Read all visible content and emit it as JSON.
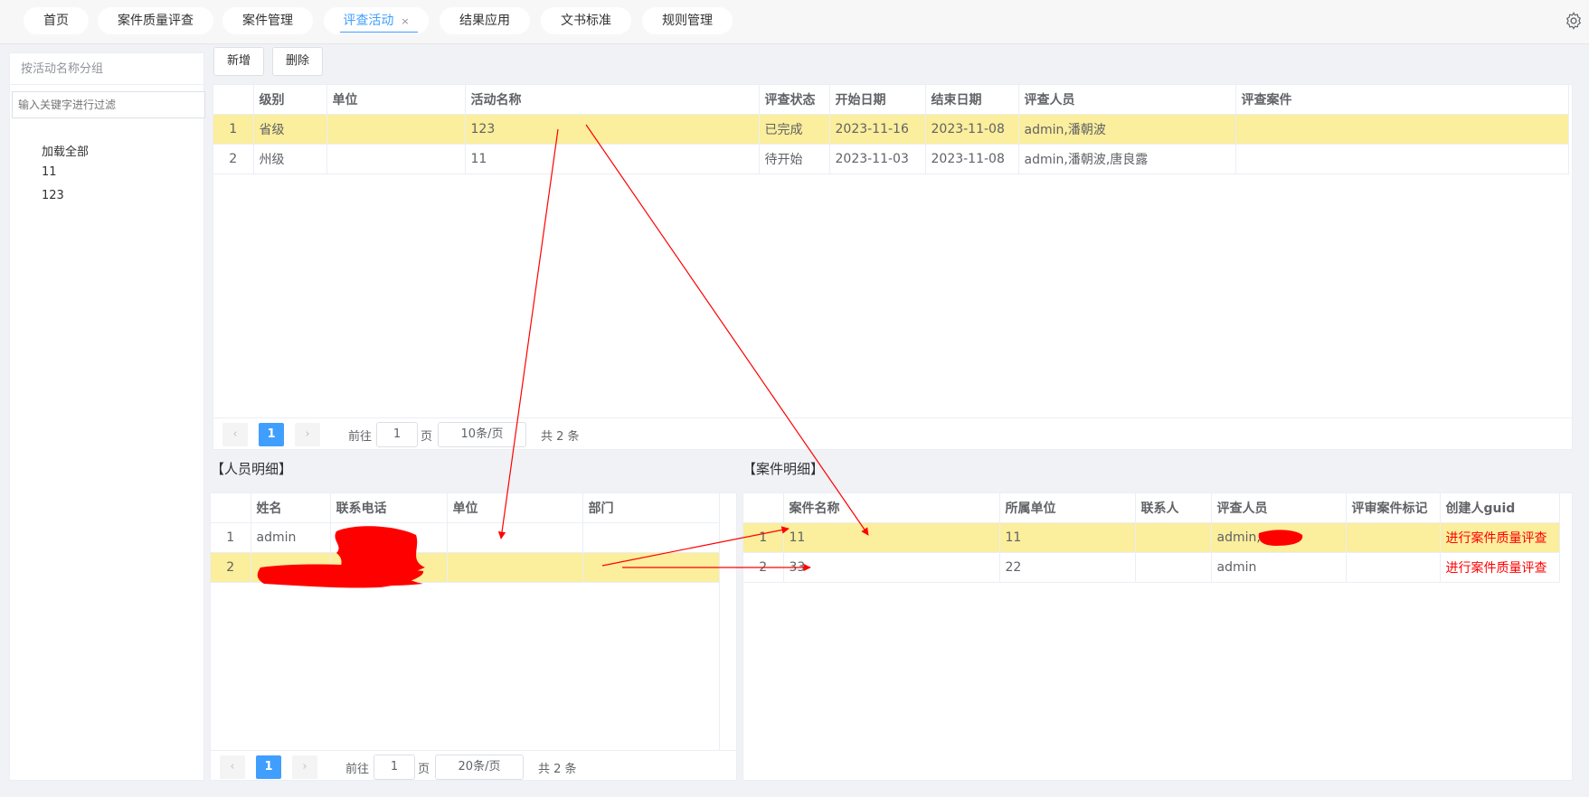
{
  "tabs": [
    {
      "label": "首页"
    },
    {
      "label": "案件质量评查"
    },
    {
      "label": "案件管理"
    },
    {
      "label": "评查活动",
      "close": "×"
    },
    {
      "label": "结果应用"
    },
    {
      "label": "文书标准"
    },
    {
      "label": "规则管理"
    }
  ],
  "sidebar": {
    "group_title": "按活动名称分组",
    "filter_placeholder": "输入关键字进行过滤",
    "items": [
      {
        "label": "加载全部"
      },
      {
        "label": "11"
      },
      {
        "label": "123"
      }
    ]
  },
  "toolbar": {
    "add_label": "新增",
    "delete_label": "删除"
  },
  "activity_table": {
    "columns": [
      "",
      "级别",
      "单位",
      "活动名称",
      "评查状态",
      "开始日期",
      "结束日期",
      "评查人员",
      "评查案件"
    ],
    "rows": [
      {
        "idx": "1",
        "level": "省级",
        "unit": "",
        "name": "123",
        "status": "已完成",
        "start": "2023-11-16",
        "end": "2023-11-08",
        "reviewers": "admin,潘朝波",
        "cases": ""
      },
      {
        "idx": "2",
        "level": "州级",
        "unit": "",
        "name": "11",
        "status": "待开始",
        "start": "2023-11-03",
        "end": "2023-11-08",
        "reviewers": "admin,潘朝波,唐良露",
        "cases": ""
      }
    ],
    "pager": {
      "prev": "‹",
      "page": "1",
      "next": "›",
      "goto": "前往",
      "goto_value": "1",
      "page_unit": "页",
      "size": "10条/页",
      "total": "共 2 条"
    }
  },
  "people_section": {
    "title": "【人员明细】",
    "columns": [
      "",
      "姓名",
      "联系电话",
      "单位",
      "部门"
    ],
    "rows": [
      {
        "idx": "1",
        "name": "admin",
        "phone": "",
        "unit": "",
        "dept": ""
      },
      {
        "idx": "2",
        "name": "",
        "phone": "",
        "unit": "",
        "dept": ""
      }
    ],
    "pager": {
      "prev": "‹",
      "page": "1",
      "next": "›",
      "goto": "前往",
      "goto_value": "1",
      "page_unit": "页",
      "size": "20条/页",
      "total": "共 2 条"
    }
  },
  "case_section": {
    "title": "【案件明细】",
    "columns": [
      "",
      "案件名称",
      "所属单位",
      "联系人",
      "评查人员",
      "评审案件标记",
      "创建人guid"
    ],
    "rows": [
      {
        "idx": "1",
        "name": "11",
        "unit": "11",
        "contact": "",
        "reviewers": "admin,",
        "mark": "",
        "action": "进行案件质量评查"
      },
      {
        "idx": "2",
        "name": "33",
        "unit": "22",
        "contact": "",
        "reviewers": "admin",
        "mark": "",
        "action": "进行案件质量评查"
      }
    ]
  },
  "colors": {
    "accent": "#409eff",
    "highlight": "#fbee9c",
    "annotation": "#ff0000"
  }
}
